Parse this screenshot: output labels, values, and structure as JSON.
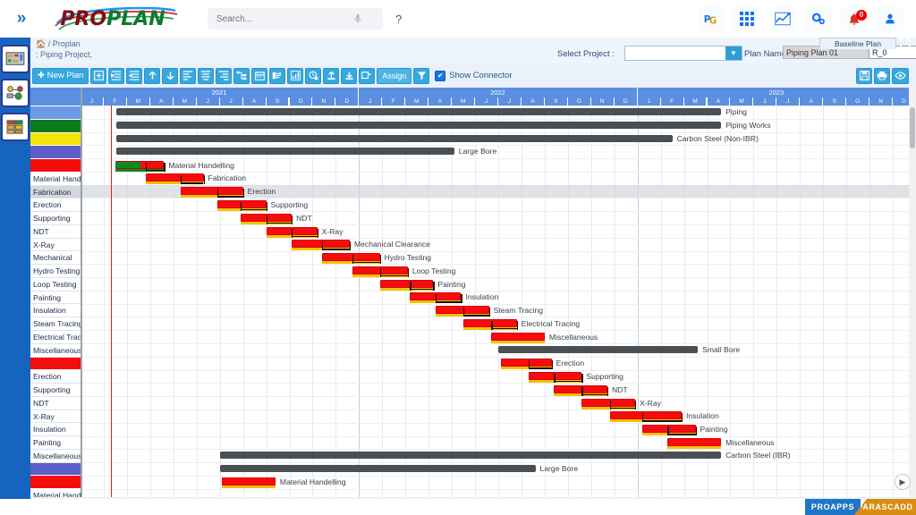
{
  "app": {
    "brand_part1": "PRO",
    "brand_part2": "PLAN",
    "collapse_icon": "»"
  },
  "topbar": {
    "search_placeholder": "Search...",
    "help_label": "?",
    "icons": [
      {
        "name": "pg-logo-icon",
        "label": "PG"
      },
      {
        "name": "apps-grid-icon",
        "label": ""
      },
      {
        "name": "analytics-chart-icon",
        "label": ""
      },
      {
        "name": "settings-gears-icon",
        "label": ""
      },
      {
        "name": "notifications-bell-icon",
        "label": "",
        "badge": "0"
      },
      {
        "name": "user-profile-icon",
        "label": ""
      }
    ]
  },
  "rail": {
    "items": [
      {
        "name": "sidebar-app-proplan"
      },
      {
        "name": "sidebar-app-network"
      },
      {
        "name": "sidebar-app-modules"
      }
    ]
  },
  "subheader": {
    "breadcrumb_home": "🏠 / Proplan",
    "breadcrumb_project": ": Piping Project,",
    "select_project_label": "Select Project :",
    "select_project_value": "",
    "plan_name_label": "Plan Name :",
    "plan_name_value": "Piping Plan 01",
    "revision_value": "R_0",
    "baseline_tab": "Baseline Plan"
  },
  "toolbar": {
    "new_plan_label": "New Plan",
    "assign_label": "Assign",
    "show_connector_label": "Show Connector",
    "show_connector_checked": true,
    "check_glyph": "✔",
    "buttons": [
      {
        "name": "add-row-button",
        "glyph": "✚"
      },
      {
        "name": "indent-button",
        "glyph": "≡"
      },
      {
        "name": "outdent-button",
        "glyph": "≡"
      },
      {
        "name": "move-up-button",
        "glyph": "↑"
      },
      {
        "name": "move-down-button",
        "glyph": "↓"
      },
      {
        "name": "align-left-button",
        "glyph": "≡"
      },
      {
        "name": "align-center-button",
        "glyph": "≡"
      },
      {
        "name": "align-right-button",
        "glyph": "≡"
      },
      {
        "name": "network-diagram-button",
        "glyph": "⑂"
      },
      {
        "name": "calendar-button",
        "glyph": "☷"
      },
      {
        "name": "resource-button",
        "glyph": "⚘"
      },
      {
        "name": "report-chart-button",
        "glyph": "ᴶ"
      },
      {
        "name": "progress-clock-button",
        "glyph": "◔"
      },
      {
        "name": "upload-button",
        "glyph": "⬆"
      },
      {
        "name": "download-button",
        "glyph": "⬇"
      },
      {
        "name": "copy-add-button",
        "glyph": "⊞"
      }
    ],
    "right_buttons": [
      {
        "name": "save-button",
        "glyph": "Ὃe"
      },
      {
        "name": "print-button",
        "glyph": "⎙"
      },
      {
        "name": "preview-eye-button",
        "glyph": "◉"
      }
    ]
  },
  "chart_data": {
    "type": "gantt",
    "title": "Piping Plan 01 — Baseline Plan",
    "years": [
      "2021",
      "2022",
      "2023"
    ],
    "months": [
      "J",
      "F",
      "M",
      "A",
      "M",
      "J",
      "J",
      "A",
      "S",
      "O",
      "N",
      "D"
    ],
    "time_start": "2021-01",
    "time_end": "2023-12",
    "today_marker_month": 1.3,
    "selected_row_index": 6,
    "rows": [
      {
        "label": "",
        "type": "colorband",
        "color": "#6b9ae8"
      },
      {
        "label": "",
        "type": "colorband",
        "color": "#0d7a1e"
      },
      {
        "label": "",
        "type": "colorband",
        "color": "#f2e600"
      },
      {
        "label": "",
        "type": "colorband",
        "color": "#5a5fc7"
      },
      {
        "label": "",
        "type": "colorband",
        "color": "#f50c0c"
      },
      {
        "label": "Material Handelling",
        "type": "colorband",
        "color": "#6b9ae8",
        "hidden_band": true
      },
      {
        "label": "Fabrication",
        "type": "task"
      },
      {
        "label": "Erection",
        "type": "task"
      },
      {
        "label": "Supporting",
        "type": "task"
      },
      {
        "label": "NDT",
        "type": "task"
      },
      {
        "label": "X-Ray",
        "type": "task"
      },
      {
        "label": "Mechanical",
        "type": "task"
      },
      {
        "label": "Hydro Testing",
        "type": "task"
      },
      {
        "label": "Loop Testing",
        "type": "task"
      },
      {
        "label": "Painting",
        "type": "task"
      },
      {
        "label": "Insulation",
        "type": "task"
      },
      {
        "label": "Steam Tracing",
        "type": "task"
      },
      {
        "label": "Electrical Tracing",
        "type": "task"
      },
      {
        "label": "Miscellaneous",
        "type": "task"
      }
    ],
    "task_list": [
      {
        "label": "",
        "color": "#6b9ae8"
      },
      {
        "label": "",
        "color": "#0d7a1e"
      },
      {
        "label": "",
        "color": "#f2e600"
      },
      {
        "label": "",
        "color": "#5a5fc7"
      },
      {
        "label": "",
        "color": "#f50c0c"
      },
      {
        "label": "Material Handelling"
      },
      {
        "label": "Fabrication",
        "selected": true
      },
      {
        "label": "Erection"
      },
      {
        "label": "Supporting"
      },
      {
        "label": "NDT"
      },
      {
        "label": "X-Ray"
      },
      {
        "label": "Mechanical"
      },
      {
        "label": "Hydro Testing"
      },
      {
        "label": "Loop Testing"
      },
      {
        "label": "Painting"
      },
      {
        "label": "Insulation"
      },
      {
        "label": "Steam Tracing"
      },
      {
        "label": "Electrical Tracing"
      },
      {
        "label": "Miscellaneous"
      },
      {
        "label": "",
        "color": "#f50c0c"
      },
      {
        "label": "Erection"
      },
      {
        "label": "Supporting"
      },
      {
        "label": "NDT"
      },
      {
        "label": "X-Ray"
      },
      {
        "label": "Insulation"
      },
      {
        "label": "Painting"
      },
      {
        "label": "Miscellaneous"
      },
      {
        "label": "",
        "color": "#5a5fc7"
      },
      {
        "label": "",
        "color": "#f50c0c"
      },
      {
        "label": "Material Handelling"
      }
    ],
    "bars": [
      {
        "row": 0,
        "kind": "summary",
        "start_m": 1.55,
        "end_m": 27.6,
        "label": "Piping"
      },
      {
        "row": 1,
        "kind": "summary",
        "start_m": 1.55,
        "end_m": 27.6,
        "label": "Piping Works"
      },
      {
        "row": 2,
        "kind": "summary",
        "start_m": 1.55,
        "end_m": 25.5,
        "label": "Carbon Steel (Non-IBR)"
      },
      {
        "row": 3,
        "kind": "summary",
        "start_m": 1.55,
        "end_m": 16.1,
        "label": "Large Bore"
      },
      {
        "row": 4,
        "kind": "task",
        "start_m": 1.52,
        "end_m": 3.6,
        "label": "Material Handelling",
        "progress": 0.52,
        "progress_color": "#0a8a22"
      },
      {
        "row": 5,
        "kind": "task",
        "start_m": 2.8,
        "end_m": 5.3,
        "label": "Fabrication",
        "progress": 1.0
      },
      {
        "row": 6,
        "kind": "task",
        "start_m": 4.3,
        "end_m": 7.0,
        "label": "Erection",
        "progress": 1.0
      },
      {
        "row": 7,
        "kind": "task",
        "start_m": 5.9,
        "end_m": 8.0,
        "label": "Supporting",
        "progress": 1.0
      },
      {
        "row": 8,
        "kind": "task",
        "start_m": 6.9,
        "end_m": 9.1,
        "label": "NDT",
        "progress": 1.0
      },
      {
        "row": 9,
        "kind": "task",
        "start_m": 8.0,
        "end_m": 10.2,
        "label": "X-Ray",
        "progress": 1.0
      },
      {
        "row": 10,
        "kind": "task",
        "start_m": 9.1,
        "end_m": 11.6,
        "label": "Mechanical Clearance",
        "progress": 1.0
      },
      {
        "row": 11,
        "kind": "task",
        "start_m": 10.4,
        "end_m": 12.9,
        "label": "Hydro Testing",
        "progress": 1.0
      },
      {
        "row": 12,
        "kind": "task",
        "start_m": 11.7,
        "end_m": 14.1,
        "label": "Loop Testing",
        "progress": 1.0
      },
      {
        "row": 13,
        "kind": "task",
        "start_m": 12.9,
        "end_m": 15.2,
        "label": "Painting",
        "progress": 1.0
      },
      {
        "row": 14,
        "kind": "task",
        "start_m": 14.2,
        "end_m": 16.4,
        "label": "Insulation",
        "progress": 1.0
      },
      {
        "row": 15,
        "kind": "task",
        "start_m": 15.3,
        "end_m": 17.6,
        "label": "Steam Tracing",
        "progress": 1.0
      },
      {
        "row": 16,
        "kind": "task",
        "start_m": 16.5,
        "end_m": 18.8,
        "label": "Electrical Tracing",
        "progress": 1.0
      },
      {
        "row": 17,
        "kind": "task",
        "start_m": 17.7,
        "end_m": 20.0,
        "label": "Miscellaneous",
        "progress": 1.0
      },
      {
        "row": 18,
        "kind": "summary",
        "start_m": 18.0,
        "end_m": 26.6,
        "label": "Small Bore"
      },
      {
        "row": 19,
        "kind": "task",
        "start_m": 18.1,
        "end_m": 20.3,
        "label": "Erection",
        "progress": 1.0
      },
      {
        "row": 20,
        "kind": "task",
        "start_m": 19.3,
        "end_m": 21.6,
        "label": "Supporting",
        "progress": 1.0
      },
      {
        "row": 21,
        "kind": "task",
        "start_m": 20.4,
        "end_m": 22.7,
        "label": "NDT",
        "progress": 1.0
      },
      {
        "row": 22,
        "kind": "task",
        "start_m": 21.6,
        "end_m": 23.9,
        "label": "X-Ray",
        "progress": 1.0
      },
      {
        "row": 23,
        "kind": "task",
        "start_m": 22.8,
        "end_m": 25.9,
        "label": "Insulation",
        "progress": 1.0
      },
      {
        "row": 24,
        "kind": "task",
        "start_m": 24.2,
        "end_m": 26.5,
        "label": "Painting",
        "progress": 1.0
      },
      {
        "row": 25,
        "kind": "task",
        "start_m": 25.3,
        "end_m": 27.6,
        "label": "Miscellaneous",
        "progress": 1.0
      },
      {
        "row": 26,
        "kind": "summary",
        "start_m": 6.0,
        "end_m": 27.6,
        "label": "Carbon Steel (IBR)"
      },
      {
        "row": 27,
        "kind": "summary",
        "start_m": 6.0,
        "end_m": 19.6,
        "label": "Large Bore"
      },
      {
        "row": 28,
        "kind": "task",
        "start_m": 6.1,
        "end_m": 8.4,
        "label": "Material Handelling",
        "progress": 1.0
      }
    ]
  },
  "footer": {
    "badge_left": "PROAPPS",
    "badge_right": "PARASCADD"
  }
}
